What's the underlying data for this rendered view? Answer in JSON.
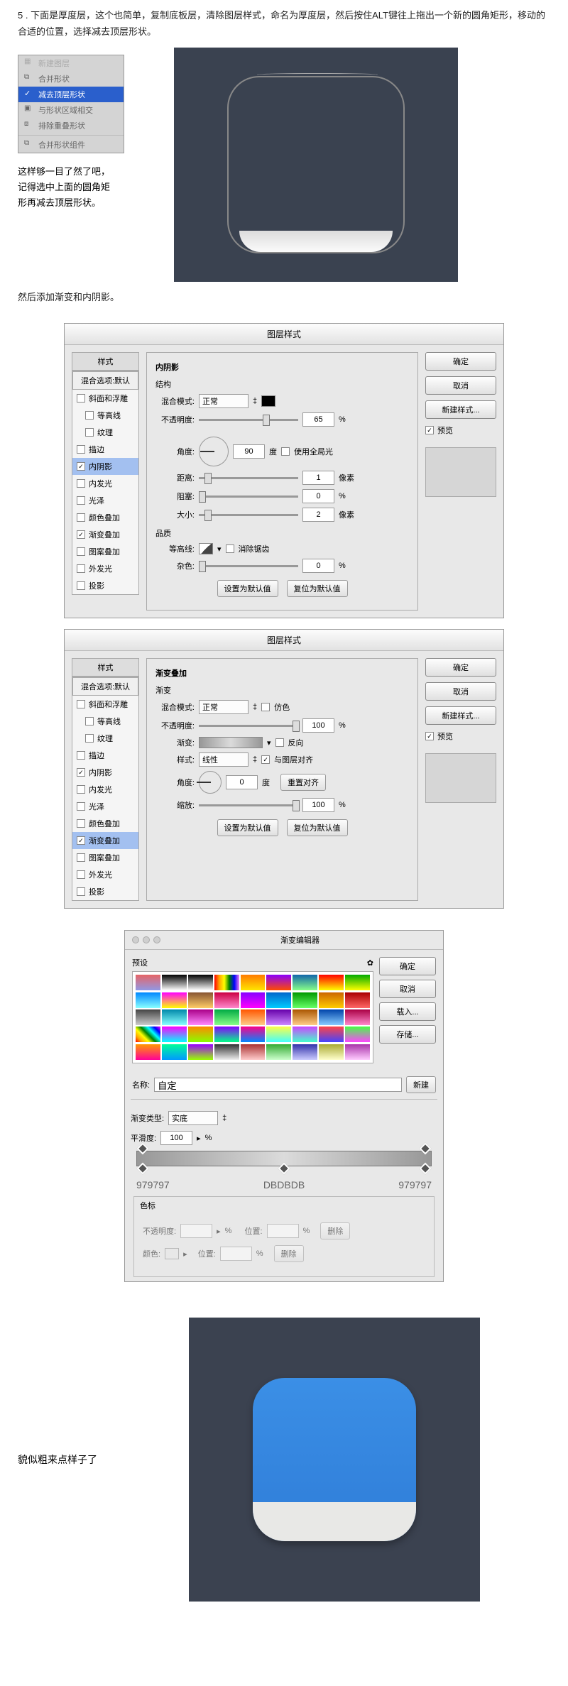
{
  "step_text": "5 . 下面是厚度层，这个也简单，复制底板层，清除图层样式，命名为厚度层，然后按住ALT键往上拖出一个新的圆角矩形，移动的合适的位置，选择减去顶层形状。",
  "context_menu": {
    "item0": "新建图层",
    "item1": "合并形状",
    "item2": "减去顶层形状",
    "item3": "与形状区域相交",
    "item4": "排除重叠形状",
    "item5": "合并形状组件"
  },
  "tip_text_1": "这样够一目了然了吧，",
  "tip_text_2": "记得选中上面的圆角矩",
  "tip_text_2b": "形再减去顶层形状。",
  "add_effects": "然后添加渐变和内阴影。",
  "dialog": {
    "title": "图层样式",
    "styles_header": "样式",
    "mix_header": "混合选项:默认",
    "ok": "确定",
    "cancel": "取消",
    "new_style": "新建样式...",
    "preview": "预览"
  },
  "style_opts": {
    "bevel": "斜面和浮雕",
    "contour": "等高线",
    "texture": "纹理",
    "stroke": "描边",
    "inner_shadow": "内阴影",
    "inner_glow": "内发光",
    "satin": "光泽",
    "color_overlay": "颜色叠加",
    "gradient_overlay": "渐变叠加",
    "pattern_overlay": "图案叠加",
    "outer_glow": "外发光",
    "drop_shadow": "投影"
  },
  "inner_shadow": {
    "section": "内阴影",
    "structure": "结构",
    "blend_mode": "混合模式:",
    "blend_mode_val": "正常",
    "opacity": "不透明度:",
    "opacity_val": "65",
    "percent": "%",
    "angle": "角度:",
    "angle_val": "90",
    "angle_unit": "度",
    "global": "使用全局光",
    "distance": "距离:",
    "distance_val": "1",
    "px": "像素",
    "choke": "阻塞:",
    "choke_val": "0",
    "size": "大小:",
    "size_val": "2",
    "quality": "品质",
    "contour_label": "等高线:",
    "antialias": "消除锯齿",
    "noise": "杂色:",
    "noise_val": "0",
    "set_default": "设置为默认值",
    "reset_default": "复位为默认值"
  },
  "grad_overlay": {
    "section": "渐变叠加",
    "sub": "渐变",
    "blend_mode": "混合模式:",
    "blend_mode_val": "正常",
    "dither": "仿色",
    "opacity": "不透明度:",
    "opacity_val": "100",
    "gradient": "渐变:",
    "reverse": "反向",
    "style": "样式:",
    "style_val": "线性",
    "align": "与图层对齐",
    "angle": "角度:",
    "angle_val": "0",
    "angle_unit": "度",
    "reset_align": "重置对齐",
    "scale": "缩放:",
    "scale_val": "100"
  },
  "gradient_editor": {
    "title": "渐变编辑器",
    "presets": "预设",
    "ok": "确定",
    "cancel": "取消",
    "load": "载入...",
    "save": "存储...",
    "name_label": "名称:",
    "name_val": "自定",
    "new": "新建",
    "type_label": "渐变类型:",
    "type_val": "实底",
    "smooth_label": "平滑度:",
    "smooth_val": "100",
    "percent": "%",
    "stops_section": "色标",
    "opacity": "不透明度:",
    "position": "位置:",
    "delete": "删除",
    "color": "颜色:",
    "c1": "979797",
    "c2": "DBDBDB",
    "c3": "979797"
  },
  "final_text": "貌似粗来点样子了"
}
